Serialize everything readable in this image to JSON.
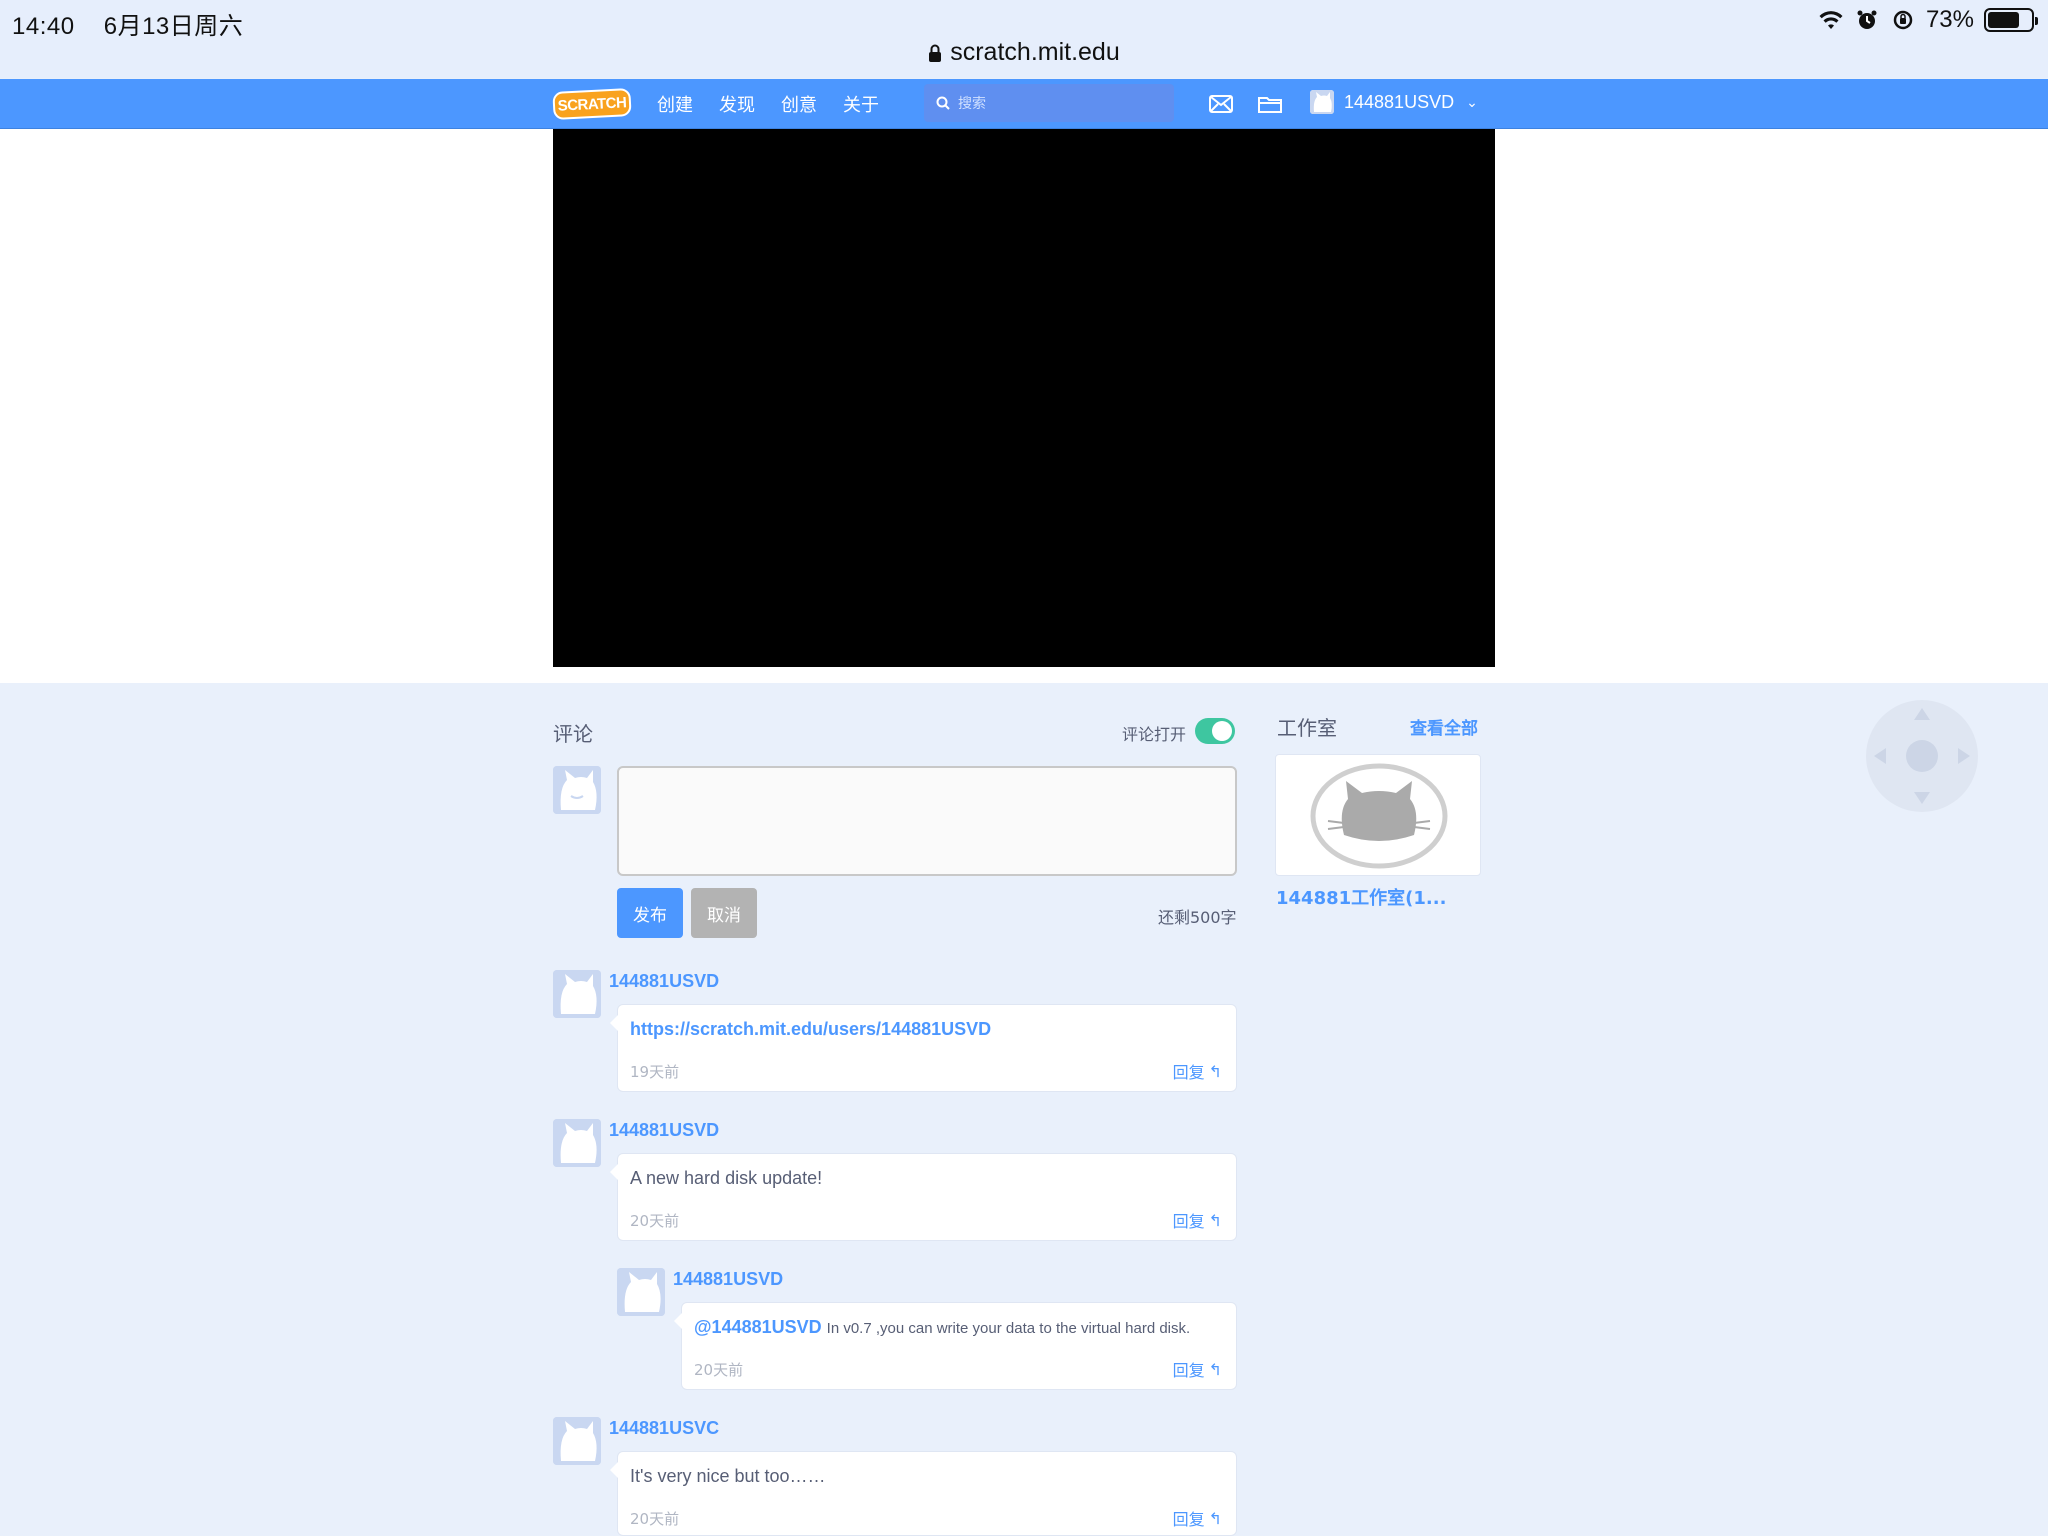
{
  "status_bar": {
    "time": "14:40",
    "date": "6月13日周六",
    "battery_percent": "73%",
    "battery_level": 0.73
  },
  "address_bar": {
    "url": "scratch.mit.edu"
  },
  "navbar": {
    "logo_text": "SCRATCH",
    "links": [
      "创建",
      "发现",
      "创意",
      "关于"
    ],
    "search_placeholder": "搜索",
    "username": "144881USVD"
  },
  "comments": {
    "title": "评论",
    "toggle_label": "评论打开",
    "toggle_on": true,
    "post_label": "发布",
    "cancel_label": "取消",
    "chars_left": "还剩500字",
    "items": [
      {
        "user": "144881USVD",
        "text": "https://scratch.mit.edu/users/144881USVD",
        "time": "19天前",
        "reply": "回复"
      },
      {
        "user": "144881USVD",
        "text": "A new hard disk update!",
        "time": "20天前",
        "reply": "回复"
      },
      {
        "user": "144881USVD",
        "mention": "@144881USVD",
        "text": "In v0.7 ,you can write your data to the virtual hard disk.",
        "time": "20天前",
        "reply": "回复"
      },
      {
        "user": "144881USVC",
        "text": "It's very nice but too……",
        "time": "20天前",
        "reply": "回复"
      }
    ]
  },
  "studios": {
    "title": "工作室",
    "view_all": "查看全部",
    "items": [
      {
        "name": "144881工作室(1..."
      }
    ]
  },
  "colors": {
    "navbar": "#4c97ff",
    "link": "#4c97ff",
    "toggle_on": "#3ec6a0"
  }
}
